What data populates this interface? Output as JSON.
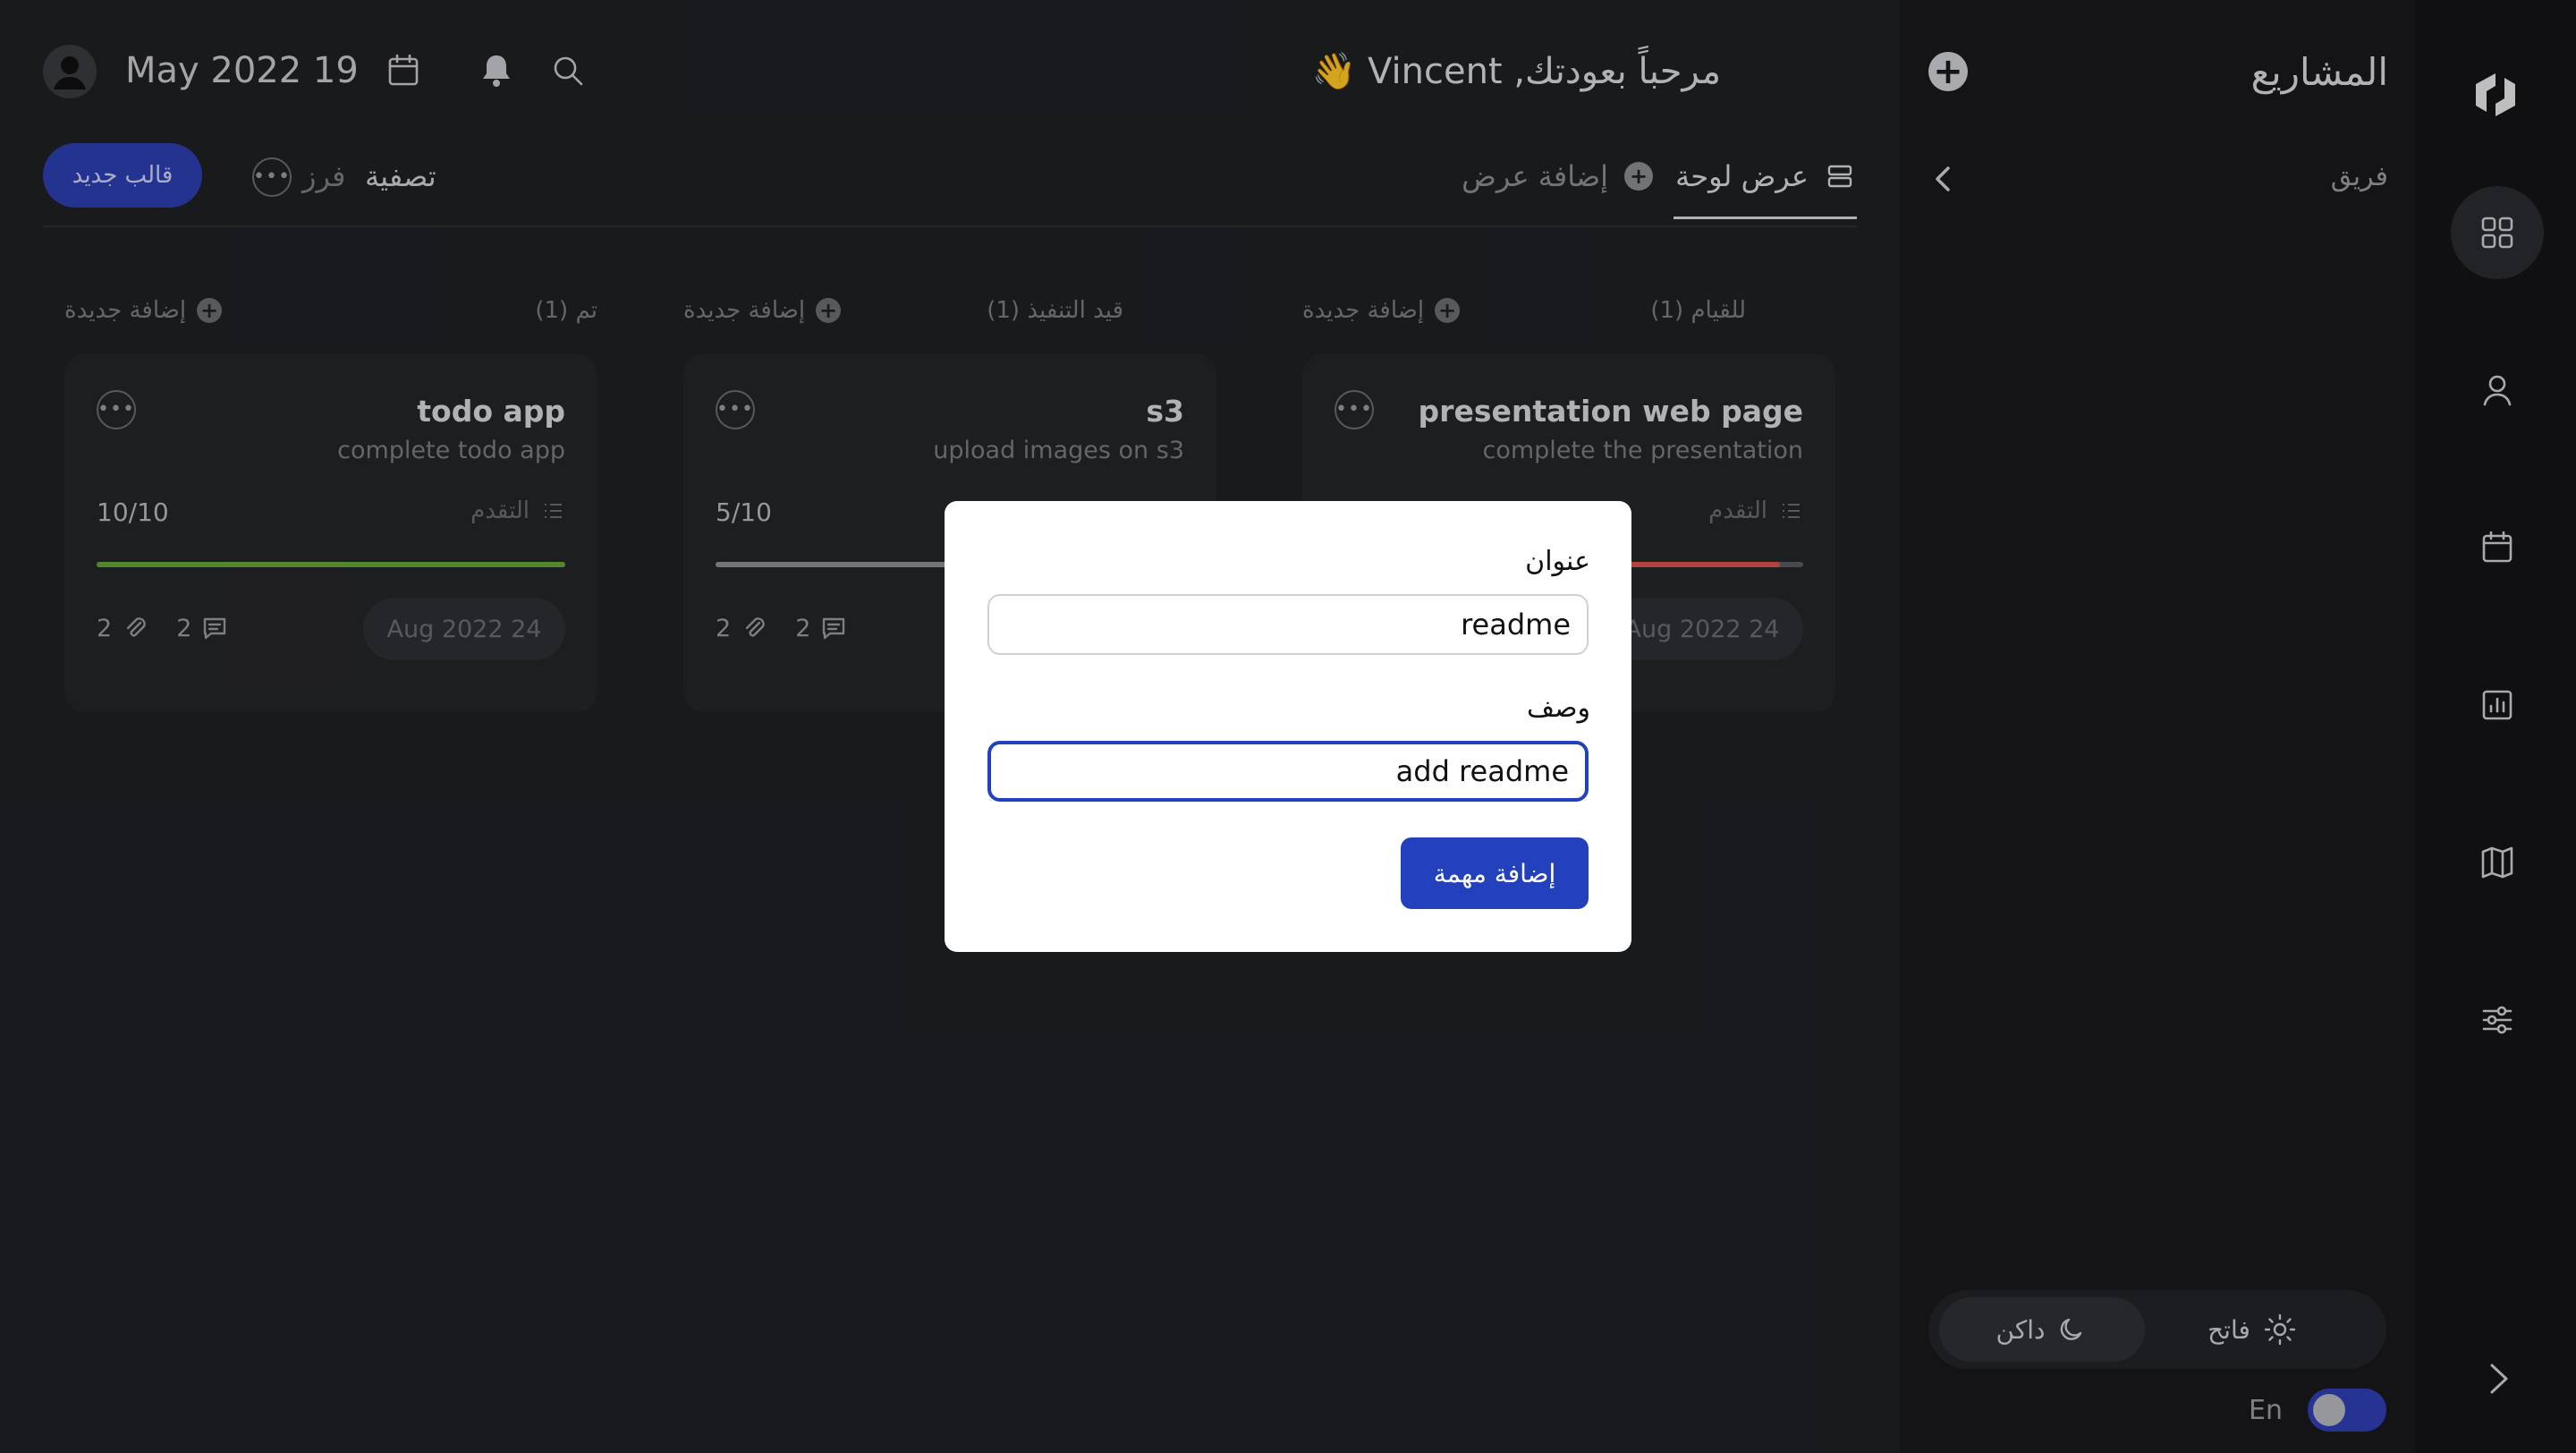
{
  "header": {
    "date": "May 2022 19",
    "welcome": "مرحباً بعودتك, Vincent 👋"
  },
  "tabs": {
    "board_view": "عرض لوحة",
    "add_view": "إضافة عرض",
    "filter": "تصفية",
    "sort": "فرز",
    "new_template": "قالب جديد",
    "more": "•••"
  },
  "sidebar": {
    "title": "المشاريع",
    "team": "فريق",
    "add": "+",
    "theme_light": "فاتح",
    "theme_dark": "داكن",
    "lang": "En",
    "lang_toggle_on": true
  },
  "columns": [
    {
      "header": "للقيام (1)",
      "add_label": "إضافة جديدة",
      "card": {
        "title": "presentation web page",
        "desc": "complete the presentation",
        "progress_label": "التقدم",
        "progress": "",
        "progress_fraction": 0.95,
        "bar_color": "#d9534f",
        "attachments": "",
        "comments": "",
        "due": "Aug 2022 24"
      }
    },
    {
      "header": "قيد التنفيذ (1)",
      "add_label": "إضافة جديدة",
      "card": {
        "title": "s3",
        "desc": "upload images on s3",
        "progress_label": "التقدم",
        "progress": "5/10",
        "progress_fraction": 0.5,
        "bar_color": "#8e8f94",
        "attachments": "2",
        "comments": "2",
        "due": ""
      }
    },
    {
      "header": "تم (1)",
      "add_label": "إضافة جديدة",
      "card": {
        "title": "todo app",
        "desc": "complete todo app",
        "progress_label": "التقدم",
        "progress": "10/10",
        "progress_fraction": 1.0,
        "bar_color": "#6aa33c",
        "attachments": "2",
        "comments": "2",
        "due": "Aug 2022 24"
      }
    }
  ],
  "modal": {
    "title_label": "عنوان",
    "title_value": "readme",
    "desc_label": "وصف",
    "desc_value": "add readme",
    "submit": "إضافة مهمة"
  },
  "colors": {
    "accent": "#2340bd",
    "background": "#1f2023",
    "card": "#242528"
  }
}
